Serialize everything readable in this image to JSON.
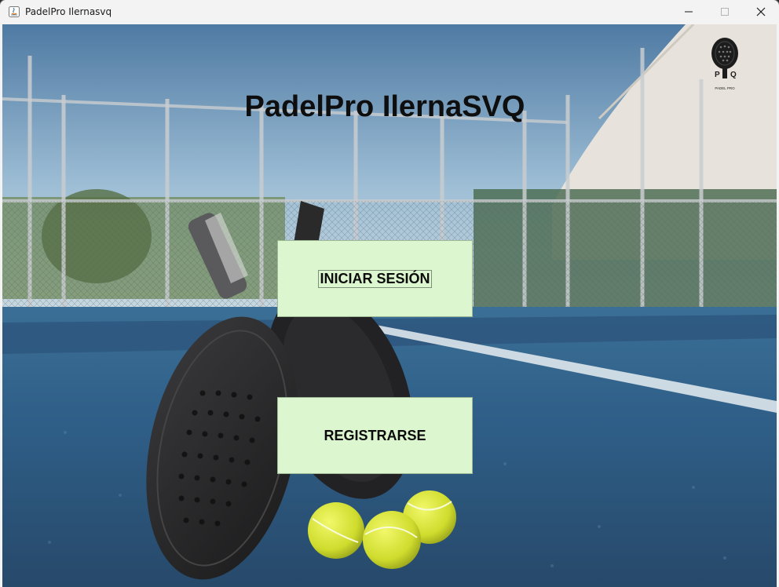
{
  "window": {
    "title": "PadelPro Ilernasvq",
    "controls": {
      "minimize_icon": "minimize-icon",
      "maximize_icon": "maximize-icon",
      "close_icon": "close-icon"
    }
  },
  "main": {
    "title": "PadelPro IlernaSVQ",
    "logo": {
      "initials_left": "P",
      "initials_right": "Q",
      "caption": "PADEL PRO"
    },
    "buttons": {
      "login_label": "INICIAR SESIÓN",
      "register_label": "REGISTRARSE"
    }
  },
  "colors": {
    "button_bg": "#dcf7cf",
    "court_blue": "#2f5d86",
    "ball_yellow": "#d8e63a"
  }
}
